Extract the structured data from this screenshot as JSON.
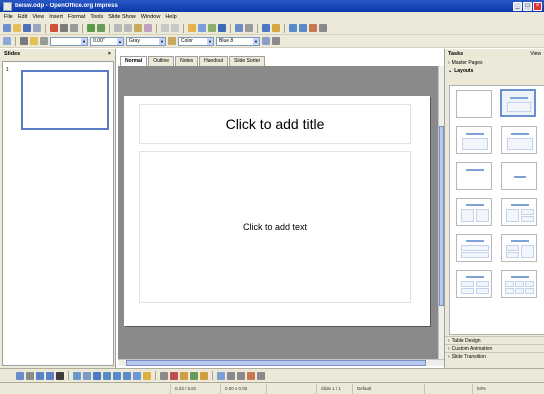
{
  "window": {
    "title": "beisw.odp - OpenOffice.org Impress",
    "buttons": [
      "_",
      "□",
      "×"
    ]
  },
  "menu": [
    "File",
    "Edit",
    "View",
    "Insert",
    "Format",
    "Tools",
    "Slide Show",
    "Window",
    "Help"
  ],
  "toolbar2": {
    "line_width": "0.00\"",
    "line_color": "Gray",
    "area_style": "Color",
    "area_color": "Blue 8"
  },
  "slides_pane": {
    "title": "Slides",
    "close": "×",
    "slide_number": "1"
  },
  "tabs": [
    "Normal",
    "Outline",
    "Notes",
    "Handout",
    "Slide Sorter"
  ],
  "slide": {
    "title_placeholder": "Click to add title",
    "body_placeholder": "Click to add text"
  },
  "tasks_pane": {
    "title": "Tasks",
    "view_label": "View",
    "sections_top": [
      "Master Pages",
      "Layouts"
    ],
    "sections_bottom": [
      "Table Design",
      "Custom Animation",
      "Slide Transition"
    ]
  },
  "statusbar": {
    "position": "0.23 / 5.81",
    "size": "0.00 x 0.00",
    "slide": "Slide 1 / 1",
    "layout": "Default",
    "zoom": "53%"
  },
  "colors": {
    "titlebar": "#0b3aa8",
    "chrome": "#ece9d8",
    "workspace": "#8a8a8a",
    "accent": "#5b7ec2"
  }
}
